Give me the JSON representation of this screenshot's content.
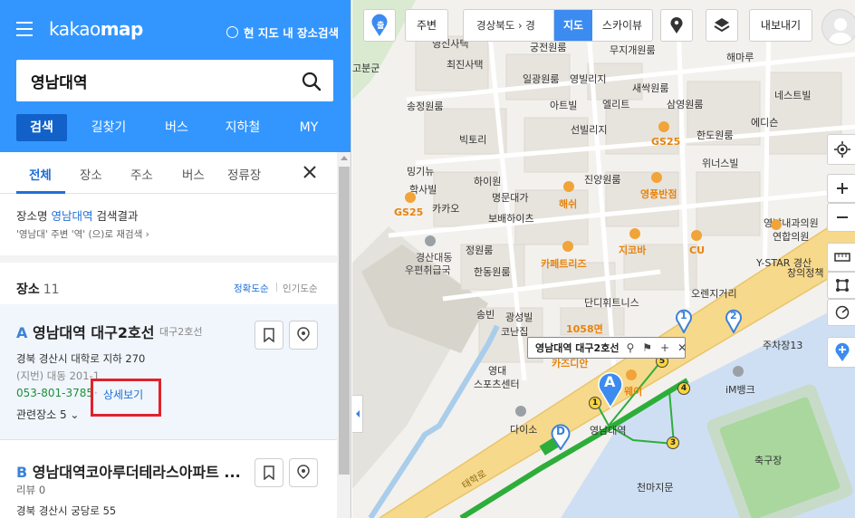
{
  "app": {
    "logo_light": "kakao",
    "logo_bold": "map",
    "scope_search": "현 지도 내 장소검색"
  },
  "search": {
    "value": "영남대역"
  },
  "nav_tabs": [
    "검색",
    "길찾기",
    "버스",
    "지하철",
    "MY"
  ],
  "sub_tabs": [
    "전체",
    "장소",
    "주소",
    "버스",
    "정류장"
  ],
  "result_info": {
    "prefix": "장소명 ",
    "keyword": "영남대역",
    "suffix": " 검색결과",
    "research": "'영남대' 주변 '역' (으)로 재검색  ›"
  },
  "places": {
    "title": "장소",
    "count": "11",
    "sort_accuracy": "정확도순",
    "sort_popular": "인기도순"
  },
  "items": [
    {
      "letter": "A",
      "name": "영남대역 대구2호선",
      "category": "대구2호선",
      "address": "경북 경산시 대학로 지하 270",
      "jibun": "(지번) 대동 201-1",
      "phone": "053-801-3785",
      "detail": "상세보기",
      "related": "관련장소 5 ⌄"
    },
    {
      "letter": "B",
      "name": "영남대역코아루더테라스아파트 ...",
      "review": "리뷰 0",
      "address": "경북 경산시 궁당로 55"
    }
  ],
  "map": {
    "start_label": "출",
    "near_button": "주변",
    "breadcrumb": "경상북도  ›  경",
    "view_map": "지도",
    "view_sky": "스카이뷰",
    "export_button": "내보내기",
    "infowindow_title": "영남대역 대구2호선",
    "marker_a": "A",
    "marker_d": "D",
    "labels": [
      "영신사택",
      "최진사택",
      "궁전원룸",
      "무지개원룸",
      "해마루",
      "고분군",
      "일광원룸",
      "영빌리지",
      "새싹원룸",
      "네스트빌",
      "송정원룸",
      "아트빌",
      "엘리트",
      "삼영원룸",
      "빅토리",
      "선빌리지",
      "GS25",
      "한도원룸",
      "에디슨",
      "밍기뉴",
      "위너스빌",
      "하이원",
      "진양원룸",
      "학사빌",
      "명문대가",
      "해쉬",
      "영풍반점",
      "카카오",
      "보배하이츠",
      "GS25",
      "영남내과의원",
      "연합의원",
      "정원룸",
      "지코바",
      "CU",
      "경산대동",
      "우편취급국",
      "한동원룸",
      "카페트리즈",
      "Y-STAR 경산",
      "창의정책",
      "단디휘트니스",
      "오렌지거리",
      "송빈",
      "광성빌",
      "1058면",
      "주차장13",
      "코난집",
      "카즈디안",
      "영대",
      "스포츠센터",
      "웨이",
      "iM뱅크",
      "다이소",
      "영남대역",
      "축구장",
      "천마지문",
      "태학로"
    ],
    "station_numbers": [
      "1",
      "2",
      "3",
      "4",
      "5"
    ],
    "exit_numbers": [
      "1",
      "2"
    ]
  },
  "colors": {
    "brand": "#3396ff",
    "nav_active": "#1161c9",
    "accent": "#1f6fd7",
    "phone": "#1f8f3a",
    "highlight_box": "#e1222a",
    "road_main": "#f7d98c",
    "line2": "#2dae3a"
  }
}
